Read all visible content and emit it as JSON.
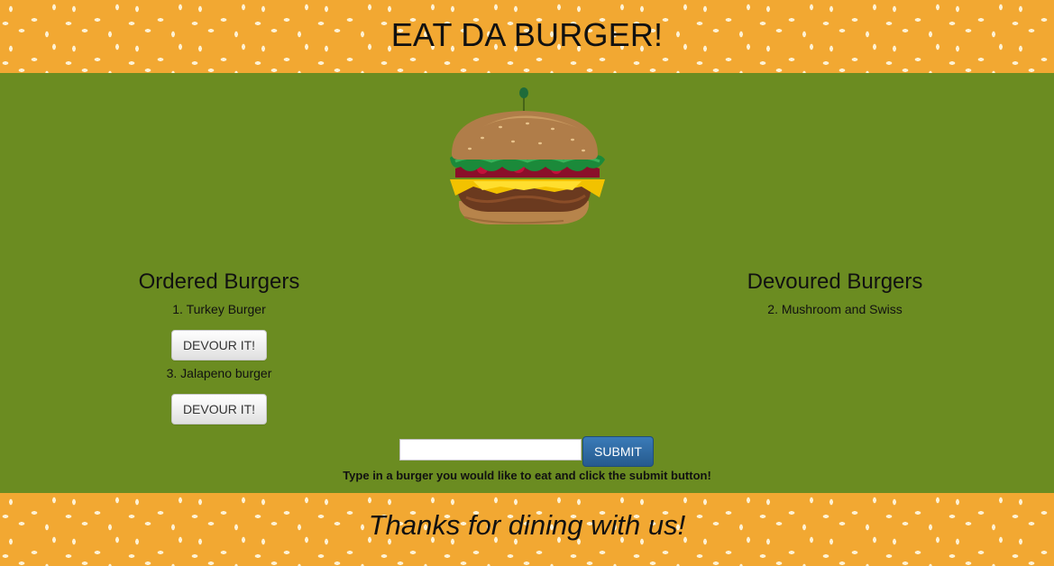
{
  "header": {
    "title": "EAT DA BURGER!"
  },
  "ordered": {
    "heading": "Ordered Burgers",
    "items": [
      {
        "label": "1. Turkey Burger",
        "button": "DEVOUR IT!"
      },
      {
        "label": "3. Jalapeno burger",
        "button": "DEVOUR IT!"
      }
    ]
  },
  "devoured": {
    "heading": "Devoured Burgers",
    "items": [
      {
        "label": "2. Mushroom and Swiss"
      }
    ]
  },
  "form": {
    "input_value": "",
    "input_placeholder": "",
    "submit_label": "SUBMIT",
    "instructions": "Type in a burger you would like to eat and click the submit button!"
  },
  "footer": {
    "text": "Thanks for dining with us!"
  },
  "colors": {
    "bun": "#f2a832",
    "main_background": "#6b8c21",
    "submit_button": "#2f6aa3"
  },
  "icons": {
    "logo": "burger-illustration"
  }
}
